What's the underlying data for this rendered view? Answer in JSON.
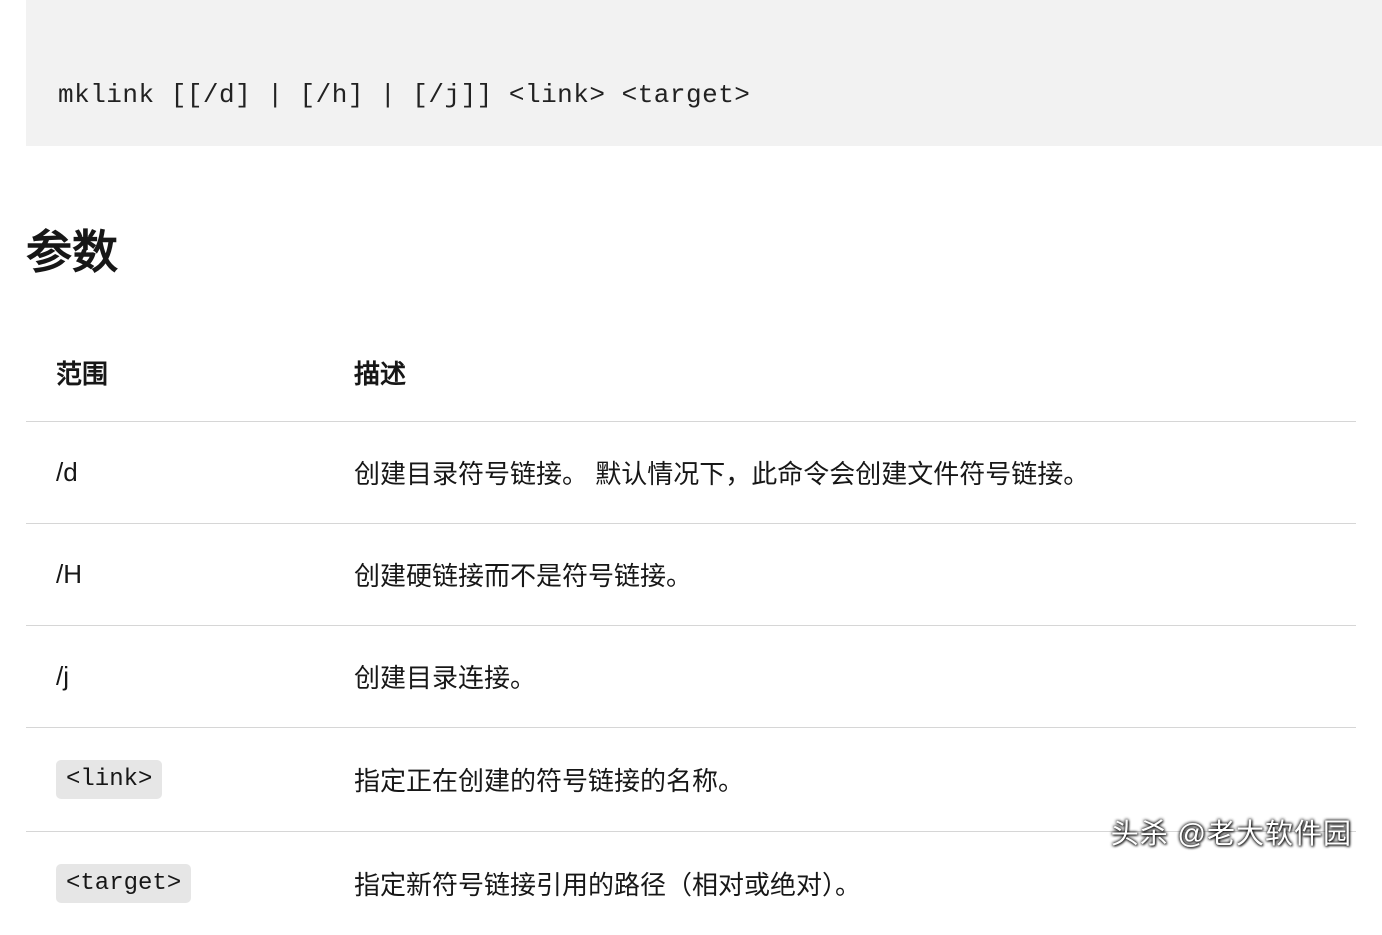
{
  "code_syntax": "mklink [[/d] | [/h] | [/j]] <link> <target>",
  "section_title": "参数",
  "table": {
    "headers": {
      "param": "范围",
      "desc": "描述"
    },
    "rows": [
      {
        "param": "/d",
        "desc": "创建目录符号链接。 默认情况下，此命令会创建文件符号链接。",
        "code_style": false
      },
      {
        "param": "/H",
        "desc": "创建硬链接而不是符号链接。",
        "code_style": false
      },
      {
        "param": "/j",
        "desc": "创建目录连接。",
        "code_style": false
      },
      {
        "param": "<link>",
        "desc": "指定正在创建的符号链接的名称。",
        "code_style": true
      },
      {
        "param": "<target>",
        "desc": "指定新符号链接引用的路径（相对或绝对）。",
        "code_style": true
      }
    ]
  },
  "watermark": "头杀 @老大软件园"
}
